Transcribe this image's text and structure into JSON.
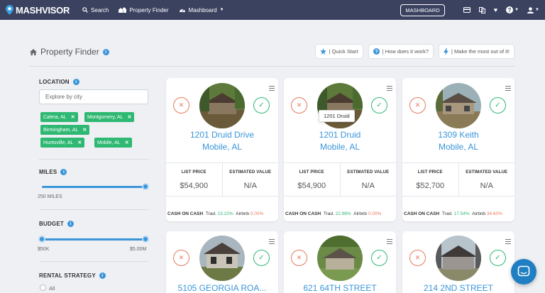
{
  "nav": {
    "brand": "MASHVISOR",
    "search": "Search",
    "property_finder": "Property Finder",
    "mashboard": "Mashboard",
    "mashboard_button": "MASHBOARD"
  },
  "header": {
    "title": "Property Finder",
    "quick_start": "| Quick Start",
    "how_it_works": "| How does it work?",
    "make_most": "| Make the most out of it!"
  },
  "sidebar": {
    "location_label": "LOCATION",
    "city_placeholder": "Explore by city",
    "tags": [
      "Calera, AL",
      "Montgomery, AL",
      "Birmingham, AL",
      "Huntsville, AL",
      "Mobile, AL"
    ],
    "miles_label": "MILES",
    "miles_value": "250 MILES",
    "miles_fraction": 1.0,
    "budget_label": "BUDGET",
    "budget_min": "$50K",
    "budget_max": "$5.00M",
    "rental_label": "RENTAL STRATEGY",
    "rental_option_all": "All"
  },
  "tooltip": "1201 Druid",
  "cards": [
    {
      "line1": "1201 Druid Drive",
      "line2": "Mobile, AL",
      "list_price_label": "LIST PRICE",
      "est_label": "ESTIMATED VALUE",
      "list_price": "$54,900",
      "est_value": "N/A",
      "coc_label": "CASH ON CASH",
      "trad_label": "Trad.",
      "trad": "23.22%",
      "airbnb_label": "Airbnb",
      "airbnb": "0.00%"
    },
    {
      "line1": "1201 Druid",
      "line2": "Mobile, AL",
      "list_price_label": "LIST PRICE",
      "est_label": "ESTIMATED VALUE",
      "list_price": "$54,900",
      "est_value": "N/A",
      "coc_label": "CASH ON CASH",
      "trad_label": "Trad.",
      "trad": "22.98%",
      "airbnb_label": "Airbnb",
      "airbnb": "0.00%"
    },
    {
      "line1": "1309 Keith",
      "line2": "Mobile, AL",
      "list_price_label": "LIST PRICE",
      "est_label": "ESTIMATED VALUE",
      "list_price": "$52,700",
      "est_value": "N/A",
      "coc_label": "CASH ON CASH",
      "trad_label": "Trad.",
      "trad": "17.54%",
      "airbnb_label": "Airbnb",
      "airbnb": "34.60%"
    },
    {
      "line1": "5105 GEORGIA ROA..."
    },
    {
      "line1": "621 64TH STREET"
    },
    {
      "line1": "214 2ND STREET"
    }
  ],
  "colors": {
    "nav_bg": "#3b4260",
    "accent_blue": "#3a95d9",
    "tag_green": "#2eb872",
    "reject_orange": "#e57a5a"
  },
  "icons": {
    "chat": "chat-bubble-icon",
    "home": "home-icon"
  }
}
